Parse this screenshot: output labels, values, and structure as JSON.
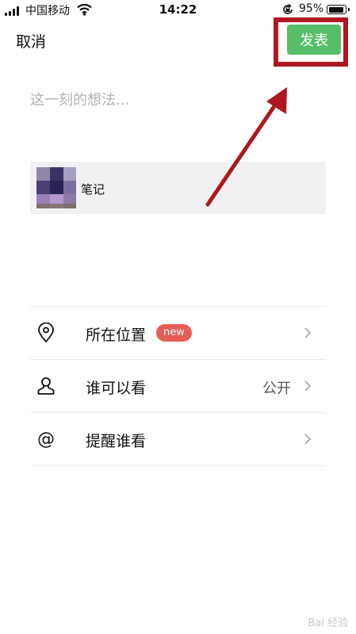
{
  "status_bar": {
    "carrier": "中国移动",
    "time": "14:22",
    "battery_percent": "95%",
    "battery_level": 0.95,
    "icons": [
      "signal-icon",
      "wifi-icon",
      "orientation-lock-icon",
      "battery-icon"
    ]
  },
  "header": {
    "cancel_label": "取消",
    "publish_label": "发表",
    "publish_color": "#57be6a",
    "highlight_color": "#b0161f"
  },
  "composer": {
    "placeholder": "这一刻的想法..."
  },
  "shared_card": {
    "title": "笔记"
  },
  "options": [
    {
      "label": "所在位置",
      "icon": "location-pin-icon",
      "badge": "new",
      "value": ""
    },
    {
      "label": "谁可以看",
      "icon": "person-icon",
      "badge": "",
      "value": "公开"
    },
    {
      "label": "提醒谁看",
      "icon": "at-icon",
      "badge": "",
      "value": ""
    }
  ],
  "watermark": "Bai 经验"
}
